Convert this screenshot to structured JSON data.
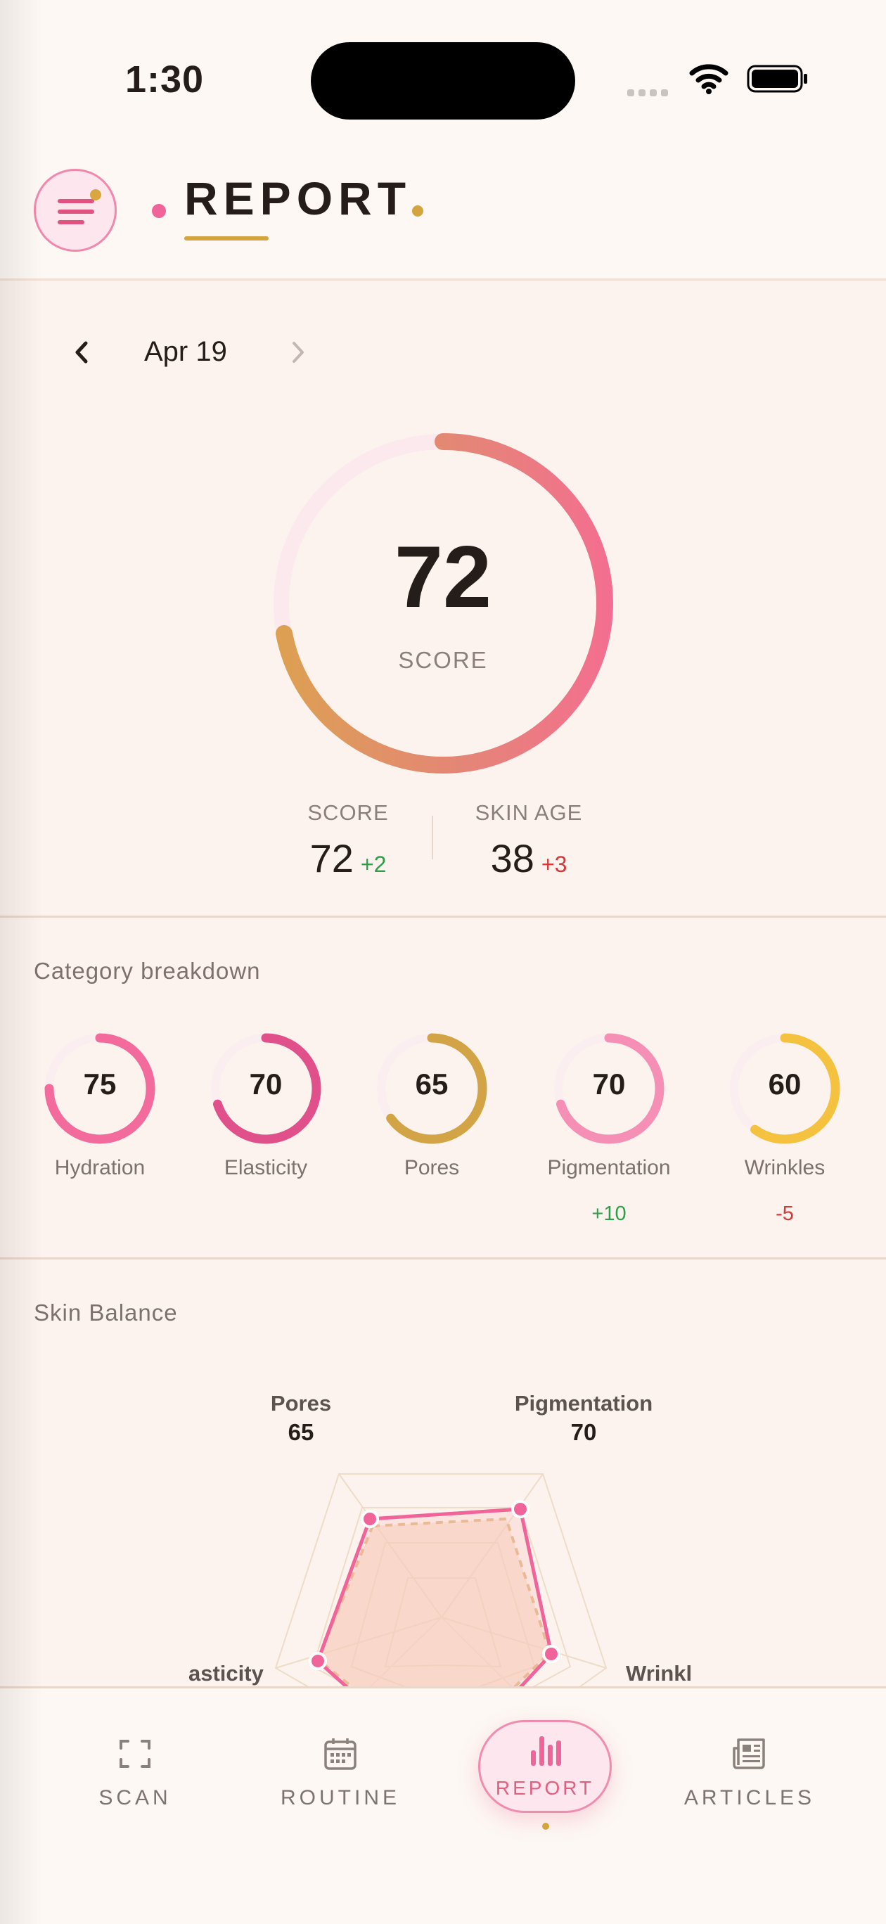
{
  "status_bar": {
    "time": "1:30"
  },
  "header": {
    "title": "REPORT"
  },
  "report": {
    "date": "Apr 19",
    "score": {
      "value": "72",
      "label": "SCORE",
      "progress": 0.72
    },
    "stats": [
      {
        "label": "SCORE",
        "value": "72",
        "delta": "+2",
        "trend": "up"
      },
      {
        "label": "SKIN AGE",
        "value": "38",
        "delta": "+3",
        "trend": "down"
      }
    ]
  },
  "categories": {
    "title": "Category breakdown",
    "items": [
      {
        "name": "Hydration",
        "value": "75",
        "progress": 0.75,
        "color": "#f26b9c",
        "delta": ""
      },
      {
        "name": "Elasticity",
        "value": "70",
        "progress": 0.7,
        "color": "#e0508a",
        "delta": ""
      },
      {
        "name": "Pores",
        "value": "65",
        "progress": 0.65,
        "color": "#d2a445",
        "delta": ""
      },
      {
        "name": "Pigmentation",
        "value": "70",
        "progress": 0.7,
        "color": "#f58fb6",
        "delta": "+10"
      },
      {
        "name": "Wrinkles",
        "value": "60",
        "progress": 0.6,
        "color": "#f5c240",
        "delta": "-5"
      }
    ]
  },
  "skin_balance": {
    "title": "Skin Balance",
    "labels": [
      {
        "name": "Pores",
        "value": "65"
      },
      {
        "name": "Pigmentation",
        "value": "70"
      },
      {
        "name": "asticity",
        "value": ""
      },
      {
        "name": "Wrinkl",
        "value": ""
      }
    ]
  },
  "nav": {
    "items": [
      {
        "label": "SCAN",
        "icon": "scan-icon"
      },
      {
        "label": "ROUTINE",
        "icon": "calendar-icon"
      },
      {
        "label": "REPORT",
        "icon": "bar-chart-icon",
        "active": true
      },
      {
        "label": "ARTICLES",
        "icon": "newspaper-icon"
      }
    ]
  },
  "colors": {
    "accent_pink": "#f0649a",
    "accent_gold": "#d4a53e",
    "positive": "#2f9e49",
    "negative": "#d63838"
  }
}
